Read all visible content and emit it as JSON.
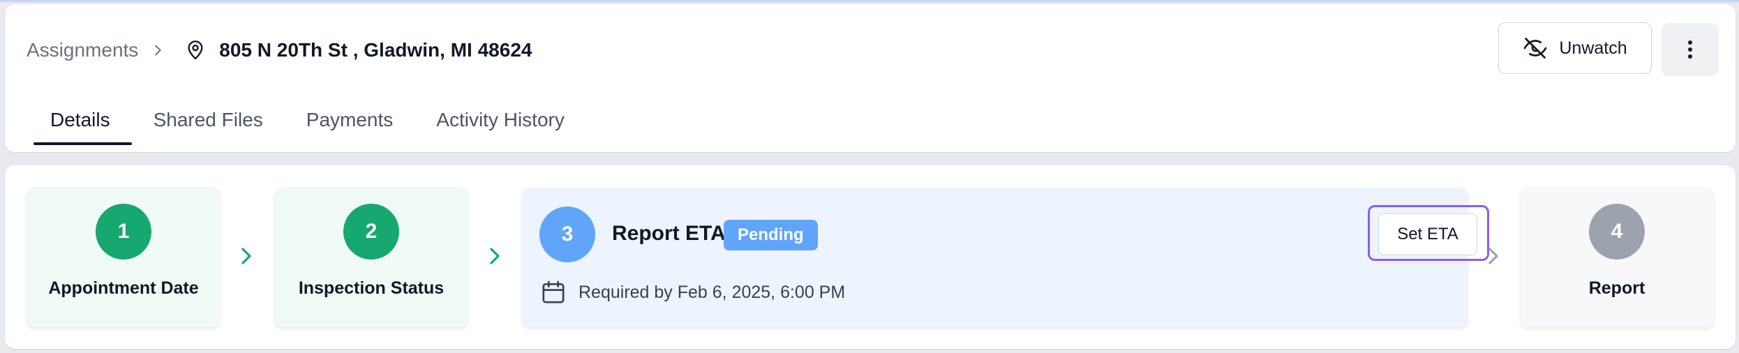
{
  "breadcrumb": {
    "parent": "Assignments",
    "address": "805 N 20Th St , Gladwin, MI 48624"
  },
  "actions": {
    "unwatch_label": "Unwatch"
  },
  "tabs": [
    {
      "label": "Details",
      "active": true
    },
    {
      "label": "Shared Files",
      "active": false
    },
    {
      "label": "Payments",
      "active": false
    },
    {
      "label": "Activity History",
      "active": false
    }
  ],
  "steps": [
    {
      "number": "1",
      "label": "Appointment Date",
      "state": "done"
    },
    {
      "number": "2",
      "label": "Inspection Status",
      "state": "done"
    },
    {
      "number": "3",
      "label": "Report ETA",
      "state": "current",
      "badge": "Pending",
      "required": "Required by Feb 6, 2025, 6:00 PM",
      "button": "Set ETA"
    },
    {
      "number": "4",
      "label": "Report",
      "state": "future"
    }
  ],
  "colors": {
    "done": "#16a870",
    "current": "#60a5fa",
    "future": "#9ca3af",
    "focus": "#8b5cf6"
  },
  "icons": {
    "breadcrumb_separator": "chevron-right-icon",
    "address": "map-pin-icon",
    "unwatch": "eye-off-icon",
    "more": "more-vertical-icon",
    "required": "calendar-icon",
    "step_connector": "chevron-right-icon"
  }
}
